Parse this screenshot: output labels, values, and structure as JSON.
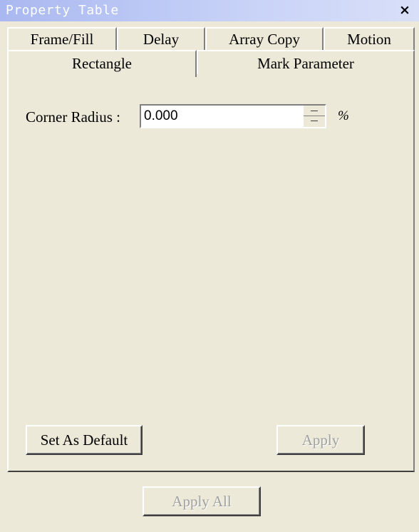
{
  "window": {
    "title": "Property Table",
    "close_label": "×"
  },
  "tabs": {
    "back_row": [
      {
        "label": "Frame/Fill"
      },
      {
        "label": "Delay"
      },
      {
        "label": "Array Copy"
      },
      {
        "label": "Motion"
      }
    ],
    "front_row": [
      {
        "label": "Rectangle",
        "active": true
      },
      {
        "label": "Mark Parameter"
      }
    ]
  },
  "panel": {
    "corner_radius": {
      "label": "Corner Radius :",
      "value": "0.000",
      "unit": "%"
    },
    "set_default_label": "Set As Default",
    "apply_label": "Apply"
  },
  "footer": {
    "apply_all_label": "Apply All"
  }
}
